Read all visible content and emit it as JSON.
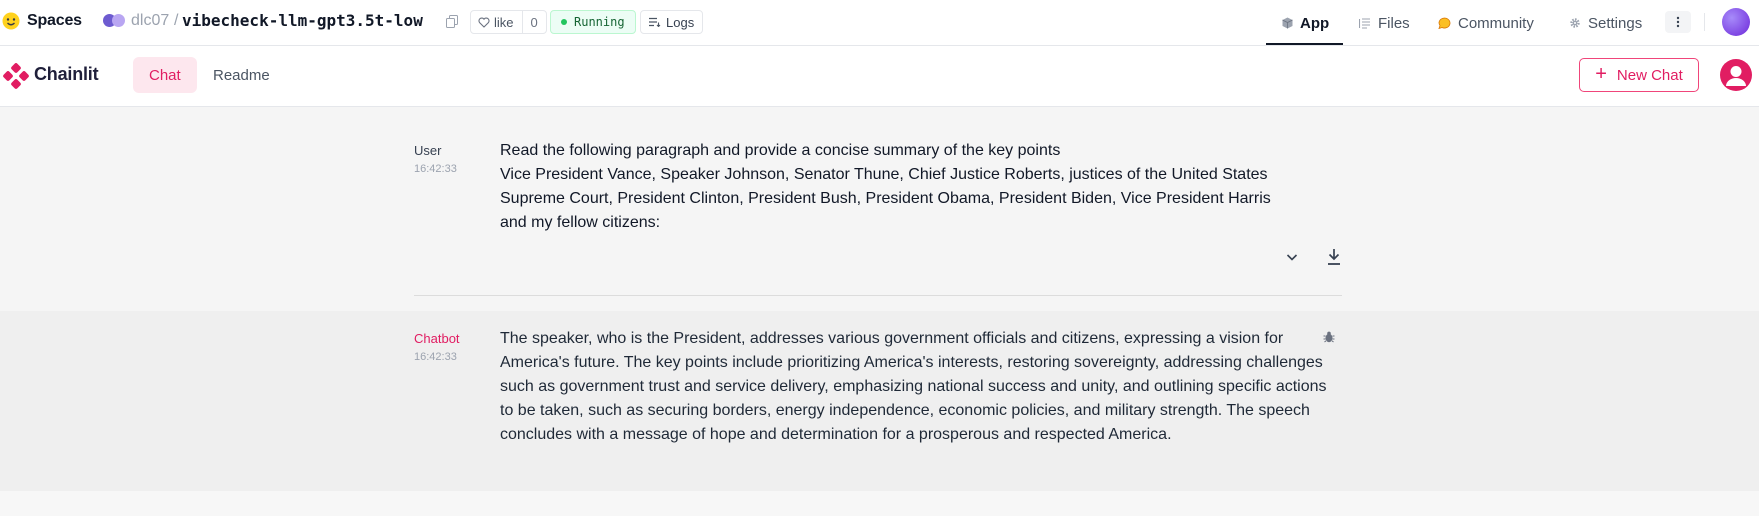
{
  "hf_bar": {
    "spaces_label": "Spaces",
    "owner": "dlc07",
    "separator": "/",
    "repo": "vibecheck-llm-gpt3.5t-low",
    "like_label": "like",
    "like_count": "0",
    "status": "Running",
    "logs_label": "Logs",
    "tabs": [
      {
        "label": "App",
        "icon": "cube-icon",
        "active": true
      },
      {
        "label": "Files",
        "icon": "files-icon",
        "active": false
      },
      {
        "label": "Community",
        "icon": "community-icon",
        "active": false
      },
      {
        "label": "Settings",
        "icon": "gear-icon",
        "active": false
      }
    ]
  },
  "chainlit": {
    "logo_text": "Chainlit",
    "tabs": [
      {
        "label": "Chat",
        "active": true
      },
      {
        "label": "Readme",
        "active": false
      }
    ],
    "new_chat_label": "New Chat",
    "accent_color": "#e11d62"
  },
  "messages": [
    {
      "author": "User",
      "time": "16:42:33",
      "lines": [
        "Read the following paragraph and provide a concise summary of the key points",
        "Vice President Vance, Speaker Johnson, Senator Thune, Chief Justice Roberts, justices of the United States",
        "Supreme Court, President Clinton, President Bush, President Obama, President Biden, Vice President Harris",
        "and my fellow citizens:"
      ]
    },
    {
      "author": "Chatbot",
      "time": "16:42:33",
      "text": "The speaker, who is the President, addresses various government officials and citizens, expressing a vision for America's future. The key points include prioritizing America's interests, restoring sovereignty, addressing challenges such as government trust and service delivery, emphasizing national success and unity, and outlining specific actions to be taken, such as securing borders, energy independence, economic policies, and military strength. The speech concludes with a message of hope and determination for a prosperous and respected America."
    }
  ]
}
